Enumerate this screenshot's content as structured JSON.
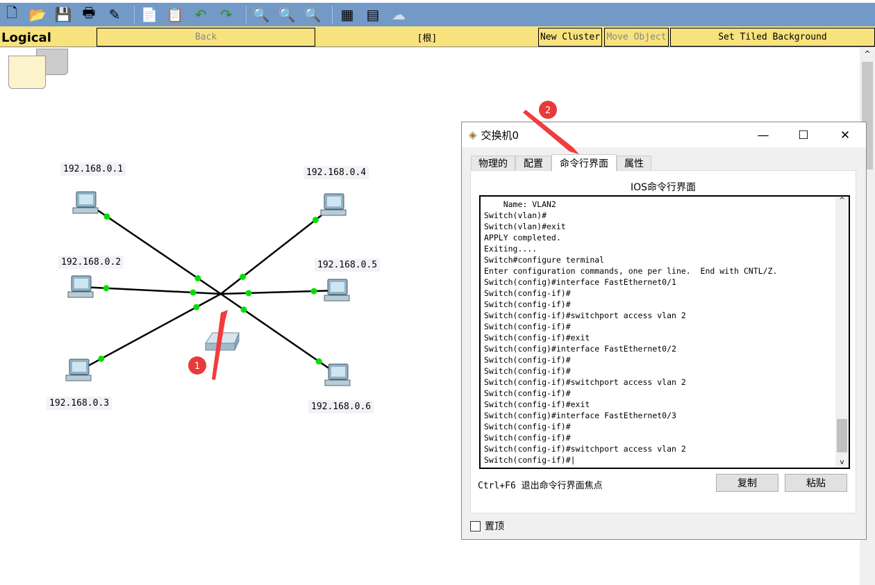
{
  "toolbar": {
    "icons": [
      "new-file-icon",
      "open-folder-icon",
      "save-icon",
      "print-icon",
      "edit-icon",
      "copy-icon",
      "paste-icon",
      "undo-icon",
      "redo-icon",
      "zoom-in-icon",
      "zoom-reset-icon",
      "zoom-out-icon",
      "palette-icon",
      "device-icon",
      "cloud-icon"
    ]
  },
  "navbar": {
    "mode": "Logical",
    "back": "Back",
    "root": "[根]",
    "new_cluster": "New Cluster",
    "move_object": "Move Object",
    "tiled_bg": "Set Tiled Background"
  },
  "network": {
    "switch": "switch-icon",
    "pcs": [
      "192.168.0.1",
      "192.168.0.2",
      "192.168.0.3",
      "192.168.0.4",
      "192.168.0.5",
      "192.168.0.6"
    ],
    "link_color": "#00e000"
  },
  "annotations": [
    "1",
    "2"
  ],
  "dialog": {
    "title": "交换机0",
    "tabs": [
      "物理的",
      "配置",
      "命令行界面",
      "属性"
    ],
    "active_tab": "命令行界面",
    "heading": "IOS命令行界面",
    "lines": [
      "    Name: VLAN2",
      "Switch(vlan)#",
      "Switch(vlan)#exit",
      "APPLY completed.",
      "Exiting....",
      "Switch#configure terminal",
      "Enter configuration commands, one per line.  End with CNTL/Z.",
      "Switch(config)#interface FastEthernet0/1",
      "Switch(config-if)#",
      "Switch(config-if)#",
      "Switch(config-if)#switchport access vlan 2",
      "Switch(config-if)#",
      "Switch(config-if)#exit",
      "Switch(config)#interface FastEthernet0/2",
      "Switch(config-if)#",
      "Switch(config-if)#",
      "Switch(config-if)#switchport access vlan 2",
      "Switch(config-if)#",
      "Switch(config-if)#exit",
      "Switch(config)#interface FastEthernet0/3",
      "Switch(config-if)#",
      "Switch(config-if)#",
      "Switch(config-if)#switchport access vlan 2",
      "Switch(config-if)#"
    ],
    "hint": "Ctrl+F6 退出命令行界面焦点",
    "copy": "复制",
    "paste": "粘贴",
    "top_label": "置顶",
    "top_checked": false
  }
}
